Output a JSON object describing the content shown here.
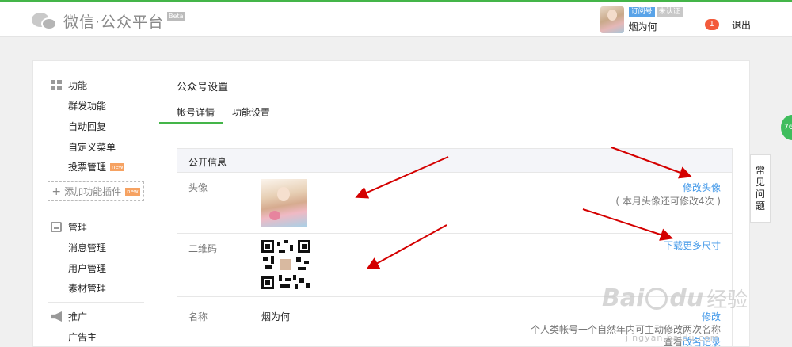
{
  "header": {
    "logo_text": "微信·公众平台",
    "logo_badge": "Beta",
    "user": {
      "tag_type": "订阅号",
      "tag_verify": "未认证",
      "name": "烟为何"
    },
    "notice_count": "1",
    "logout": "退出"
  },
  "sidebar": {
    "groups": [
      {
        "title": "功能",
        "icon": "grid-icon",
        "items": [
          {
            "label": "群发功能"
          },
          {
            "label": "自动回复"
          },
          {
            "label": "自定义菜单"
          },
          {
            "label": "投票管理",
            "badge": "new"
          }
        ]
      },
      {
        "title": "管理",
        "icon": "tray-icon",
        "items": [
          {
            "label": "消息管理"
          },
          {
            "label": "用户管理"
          },
          {
            "label": "素材管理"
          }
        ]
      },
      {
        "title": "推广",
        "icon": "horn-icon",
        "items": [
          {
            "label": "广告主"
          }
        ]
      }
    ],
    "add_plugin": {
      "label": "添加功能插件",
      "badge": "new"
    }
  },
  "main": {
    "title": "公众号设置",
    "tabs": [
      {
        "label": "帐号详情",
        "active": true
      },
      {
        "label": "功能设置",
        "active": false
      }
    ],
    "section_title": "公开信息",
    "rows": {
      "avatar": {
        "label": "头像",
        "action": "修改头像",
        "note": "( 本月头像还可修改4次 )"
      },
      "qrcode": {
        "label": "二维码",
        "action": "下载更多尺寸"
      },
      "name": {
        "label": "名称",
        "value": "烟为何",
        "action": "修改",
        "note": "个人类帐号一个自然年内可主动修改两次名称",
        "history_prefix": "查看",
        "history_link": "改名记录"
      }
    }
  },
  "float_help": {
    "chars": [
      "常",
      "见",
      "问",
      "题"
    ]
  },
  "green_dot_text": "76",
  "watermark": {
    "brand_a": "Bai",
    "brand_b": "du",
    "brand_c": "经验",
    "url": "jingyan.baidu.com"
  },
  "colors": {
    "accent_green": "#44b549",
    "link_blue": "#459ae9",
    "arrow_red": "#d40000"
  }
}
